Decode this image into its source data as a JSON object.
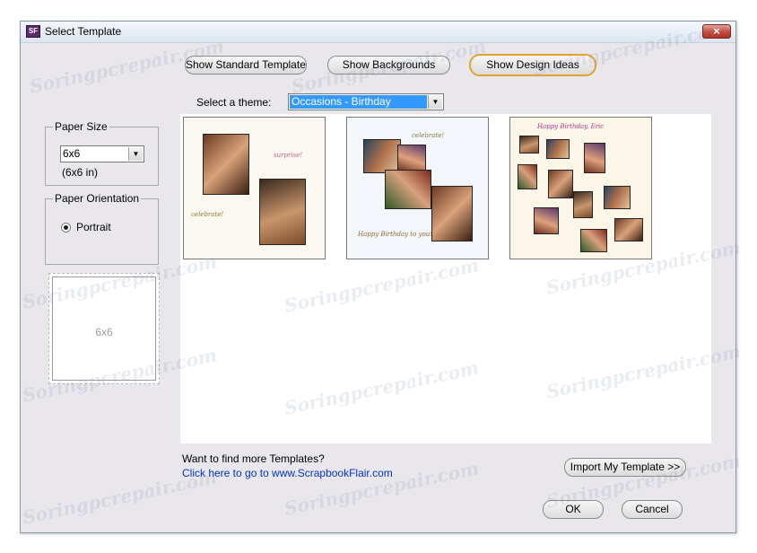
{
  "window": {
    "title": "Select Template",
    "close_label": "×",
    "app_icon_label": "SF"
  },
  "toolbar": {
    "standard_templates": "Show Standard Templates",
    "backgrounds": "Show Backgrounds",
    "design_ideas": "Show Design Ideas"
  },
  "theme": {
    "label": "Select a theme:",
    "value": "Occasions - Birthday"
  },
  "paper_size": {
    "title": "Paper Size",
    "value": "6x6",
    "sub": "(6x6 in)"
  },
  "orientation": {
    "title": "Paper Orientation",
    "option": "Portrait"
  },
  "preview": {
    "label": "6x6"
  },
  "thumbnails": [
    {
      "text1": "surprise!",
      "text2": "celebrate!"
    },
    {
      "text1": "celebrate!",
      "text2": "Happy Birthday to you!"
    },
    {
      "text1": "Happy Birthday, Eric"
    }
  ],
  "footer": {
    "more_text": "Want to find more Templates?",
    "link_text": "Click here to go to www.ScrapbookFlair.com",
    "import": "Import My Template >>",
    "ok": "OK",
    "cancel": "Cancel"
  },
  "watermark": "Soringpcrepair.com",
  "colors": {
    "accent": "#e3a232",
    "selection": "#3399ff",
    "link": "#0033cc",
    "dialog_bg": "#e9e7ec"
  }
}
